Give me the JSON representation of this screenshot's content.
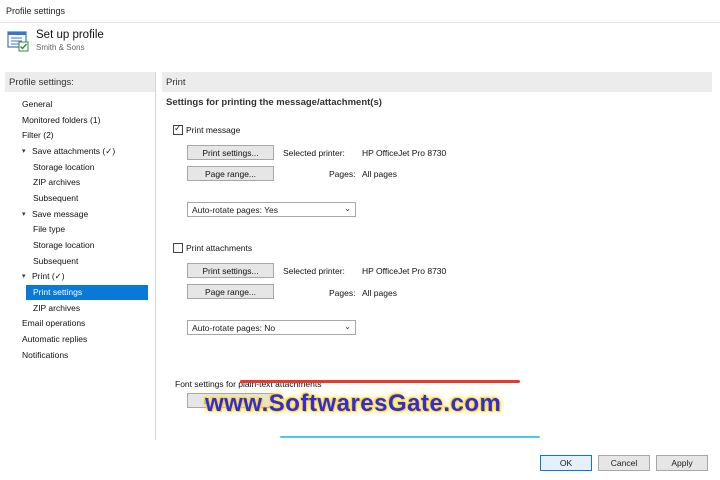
{
  "window": {
    "title": "Profile settings"
  },
  "header": {
    "title": "Set up profile",
    "subtitle": "Smith & Sons",
    "icon": "settings-document-icon"
  },
  "sidebar": {
    "heading": "Profile settings:",
    "items": [
      {
        "label": "General",
        "level": 0,
        "expander": ""
      },
      {
        "label": "Monitored folders (1)",
        "level": 0,
        "expander": ""
      },
      {
        "label": "Filter (2)",
        "level": 0,
        "expander": ""
      },
      {
        "label": "Save attachments (✓)",
        "level": 0,
        "expander": "▾"
      },
      {
        "label": "Storage location",
        "level": 1,
        "expander": ""
      },
      {
        "label": "ZIP archives",
        "level": 1,
        "expander": ""
      },
      {
        "label": "Subsequent",
        "level": 1,
        "expander": ""
      },
      {
        "label": "Save message",
        "level": 0,
        "expander": "▾"
      },
      {
        "label": "File type",
        "level": 1,
        "expander": ""
      },
      {
        "label": "Storage location",
        "level": 1,
        "expander": ""
      },
      {
        "label": "Subsequent",
        "level": 1,
        "expander": ""
      },
      {
        "label": "Print (✓)",
        "level": 0,
        "expander": "▾"
      },
      {
        "label": "Print settings",
        "level": 1,
        "expander": "",
        "selected": true
      },
      {
        "label": "ZIP archives",
        "level": 1,
        "expander": ""
      },
      {
        "label": "Email operations",
        "level": 0,
        "expander": ""
      },
      {
        "label": "Automatic replies",
        "level": 0,
        "expander": ""
      },
      {
        "label": "Notifications",
        "level": 0,
        "expander": ""
      }
    ]
  },
  "content": {
    "heading": "Print",
    "subheading": "Settings for printing the message/attachment(s)",
    "print_message": {
      "checkbox_label": "Print message",
      "checked": true,
      "print_settings_btn": "Print settings...",
      "selected_printer_label": "Selected printer:",
      "printer_name": "HP OfficeJet Pro 8730",
      "page_range_btn": "Page range...",
      "pages_label": "Pages:",
      "pages_value": "All pages",
      "autorotate_value": "Auto-rotate pages: Yes"
    },
    "print_attachments": {
      "checkbox_label": "Print attachments",
      "checked": false,
      "print_settings_btn": "Print settings...",
      "selected_printer_label": "Selected printer:",
      "printer_name": "HP OfficeJet Pro 8730",
      "page_range_btn": "Page range...",
      "pages_label": "Pages:",
      "pages_value": "All pages",
      "autorotate_value": "Auto-rotate pages: No"
    },
    "font_settings_label": "Font settings for plain-text attachments",
    "font_btn": "F"
  },
  "watermark": {
    "text": "www.SoftwaresGate.com"
  },
  "footer": {
    "ok": "OK",
    "cancel": "Cancel",
    "apply": "Apply"
  }
}
